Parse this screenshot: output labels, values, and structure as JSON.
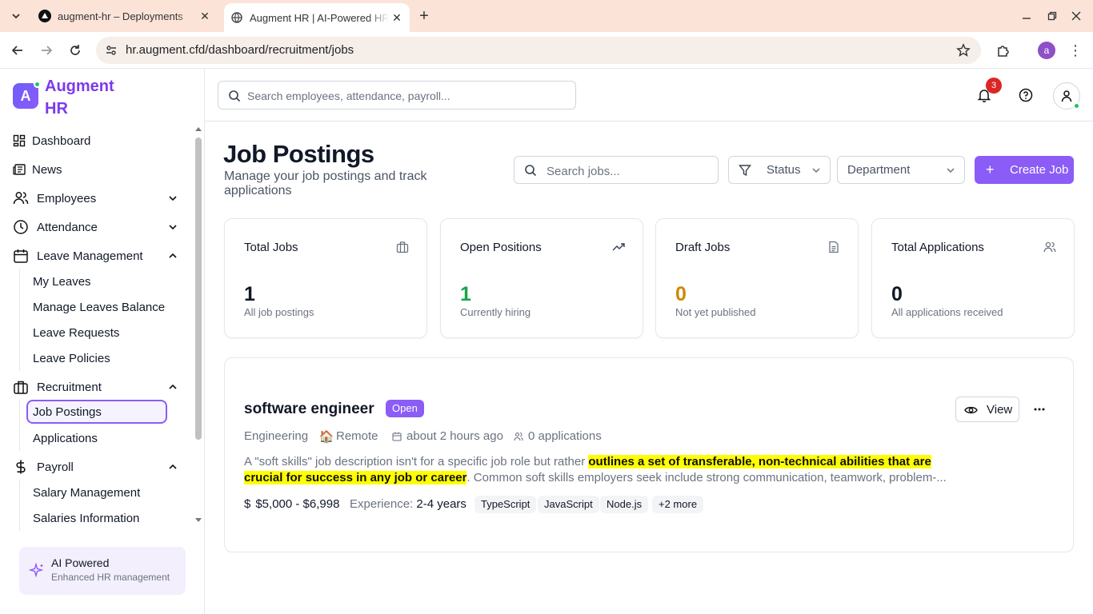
{
  "browser": {
    "tabs": [
      {
        "title": "augment-hr – Deployments",
        "active": false
      },
      {
        "title": "Augment HR | AI-Powered HR",
        "active": true
      }
    ],
    "url": "hr.augment.cfd/dashboard/recruitment/jobs",
    "profile_initial": "a"
  },
  "brand": {
    "logo_letter": "A",
    "name": "Augment HR",
    "color": "#7c3aed"
  },
  "sidebar": {
    "items": [
      {
        "label": "Dashboard",
        "icon": "dashboard-icon"
      },
      {
        "label": "News",
        "icon": "newspaper-icon"
      },
      {
        "label": "Employees",
        "icon": "users-icon",
        "expanded": false
      },
      {
        "label": "Attendance",
        "icon": "clock-icon",
        "expanded": false
      },
      {
        "label": "Leave Management",
        "icon": "calendar-icon",
        "expanded": true,
        "children": [
          "My Leaves",
          "Manage Leaves Balance",
          "Leave Requests",
          "Leave Policies"
        ]
      },
      {
        "label": "Recruitment",
        "icon": "briefcase-icon",
        "expanded": true,
        "children": [
          "Job Postings",
          "Applications"
        ]
      },
      {
        "label": "Payroll",
        "icon": "dollar-icon",
        "expanded": true,
        "children": [
          "Salary Management",
          "Salaries Information"
        ]
      }
    ],
    "active_item": "Job Postings",
    "ai_box": {
      "title": "AI Powered",
      "subtitle": "Enhanced HR management"
    }
  },
  "header": {
    "search_placeholder": "Search employees, attendance, payroll...",
    "notification_count": "3"
  },
  "page": {
    "title": "Job Postings",
    "subtitle": "Manage your job postings and track applications",
    "search_placeholder": "Search jobs...",
    "status_filter": "Status",
    "department_filter": "Department",
    "create_label": "Create Job"
  },
  "stats": [
    {
      "label": "Total Jobs",
      "value": "1",
      "desc": "All job postings",
      "icon": "briefcase-icon",
      "color": "#111827"
    },
    {
      "label": "Open Positions",
      "value": "1",
      "desc": "Currently hiring",
      "icon": "trending-up-icon",
      "color": "#16a34a"
    },
    {
      "label": "Draft Jobs",
      "value": "0",
      "desc": "Not yet published",
      "icon": "file-text-icon",
      "color": "#ca8a04"
    },
    {
      "label": "Total Applications",
      "value": "0",
      "desc": "All applications received",
      "icon": "users-icon",
      "color": "#111827"
    }
  ],
  "job": {
    "title": "software engineer",
    "status": "Open",
    "department": "Engineering",
    "location": "Remote",
    "posted": "about 2 hours ago",
    "applications": "0 applications",
    "description_before": "A \"soft skills\" job description isn't for a specific job role but rather ",
    "description_highlight": "outlines a set of transferable, non-technical abilities that are crucial for success in any job or career",
    "description_after": ". Common soft skills employers seek include strong communication, teamwork, problem-...",
    "salary": "$5,000 - $6,998",
    "experience_label": "Experience:",
    "experience_value": "2-4 years",
    "tags": [
      "TypeScript",
      "JavaScript",
      "Node.js",
      "+2 more"
    ],
    "view_label": "View"
  },
  "colors": {
    "accent": "#8b5cf6",
    "highlight": "#ffff00",
    "badge_red": "#dc2626",
    "online_green": "#22c55e"
  }
}
